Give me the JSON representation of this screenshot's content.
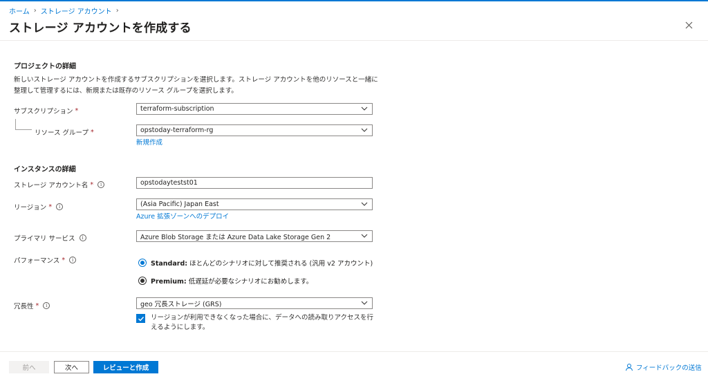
{
  "breadcrumb": {
    "home": "ホーム",
    "storage_account": "ストレージ アカウント"
  },
  "page_title": "ストレージ アカウントを作成する",
  "more_label": "···",
  "project_section": {
    "title": "プロジェクトの詳細",
    "description": "新しいストレージ アカウントを作成するサブスクリプションを選択します。ストレージ アカウントを他のリソースと一緒に整理して管理するには、新規または既存のリソース グループを選択します。",
    "subscription_label": "サブスクリプション",
    "subscription_value": "terraform-subscription",
    "resource_group_label": "リソース グループ",
    "resource_group_value": "opstoday-terraform-rg",
    "create_new_link": "新規作成"
  },
  "instance_section": {
    "title": "インスタンスの詳細",
    "account_name_label": "ストレージ アカウント名",
    "account_name_value": "opstodaytestst01",
    "region_label": "リージョン",
    "region_value": "(Asia Pacific) Japan East",
    "edge_zone_link": "Azure 拡張ゾーンへのデプロイ",
    "primary_service_label": "プライマリ サービス",
    "primary_service_value": "Azure Blob Storage または Azure Data Lake Storage Gen 2",
    "performance_label": "パフォーマンス",
    "standard_label": "Standard:",
    "standard_desc": "ほとんどのシナリオに対して推奨される (汎用 v2 アカウント)",
    "premium_label": "Premium:",
    "premium_desc": "低遅延が必要なシナリオにお勧めします。",
    "redundancy_label": "冗長性",
    "redundancy_value": "geo 冗長ストレージ (GRS)",
    "read_access_text": "リージョンが利用できなくなった場合に、データへの読み取りアクセスを行えるようにします。"
  },
  "required_mark": "*",
  "footer": {
    "prev_label": "前へ",
    "next_label": "次へ",
    "review_label": "レビューと作成",
    "feedback_label": "フィードバックの送信"
  },
  "colors": {
    "accent": "#0078d4",
    "required": "#a4262c"
  }
}
